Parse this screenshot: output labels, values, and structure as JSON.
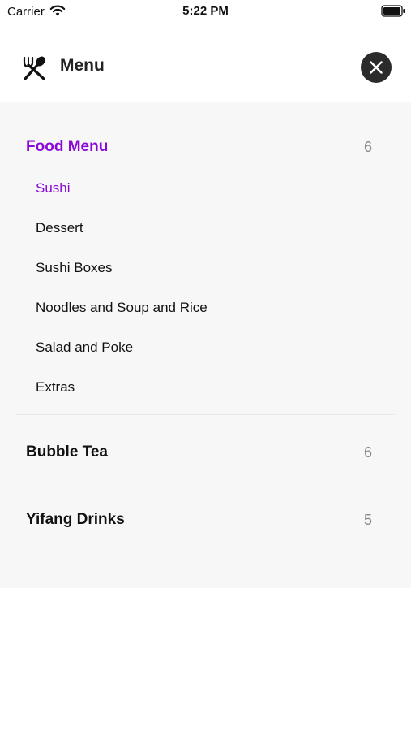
{
  "status_bar": {
    "carrier": "Carrier",
    "time": "5:22 PM"
  },
  "header": {
    "title": "Menu",
    "icon": "utensils-icon",
    "close_icon": "close-icon"
  },
  "menu": {
    "categories": [
      {
        "label": "Food Menu",
        "count": "6",
        "active": true,
        "items": [
          {
            "label": "Sushi",
            "active": true
          },
          {
            "label": "Dessert"
          },
          {
            "label": "Sushi Boxes"
          },
          {
            "label": "Noodles and Soup and Rice"
          },
          {
            "label": "Salad and Poke"
          },
          {
            "label": "Extras"
          }
        ]
      },
      {
        "label": "Bubble Tea",
        "count": "6"
      },
      {
        "label": "Yifang Drinks",
        "count": "5"
      }
    ]
  },
  "colors": {
    "accent": "#8a0ad8",
    "panel_bg": "#f7f7f7",
    "close_button_bg": "#2b2b2b"
  }
}
